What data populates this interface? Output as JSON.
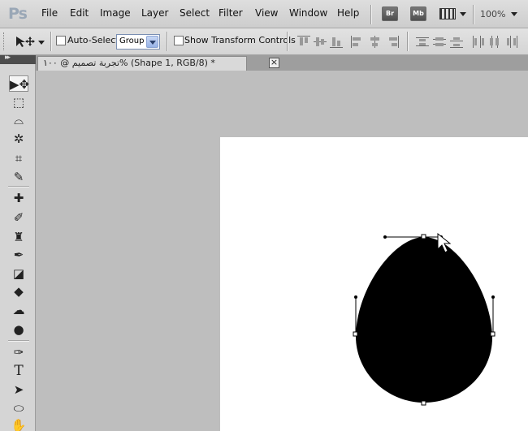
{
  "app": {
    "logo": "Ps",
    "zoom": "100%"
  },
  "menu": [
    "File",
    "Edit",
    "Image",
    "Layer",
    "Select",
    "Filter",
    "View",
    "Window",
    "Help"
  ],
  "app_buttons": {
    "bridge": "Br",
    "mini_bridge": "Mb"
  },
  "options": {
    "auto_select_label": "Auto-Select:",
    "auto_select_value": "Group",
    "show_transform_label": "Show Transform Controls"
  },
  "document": {
    "tab_title": "تجربة تصميم @ ١٠٠% (Shape 1, RGB/8) *",
    "close_glyph": "×"
  },
  "tools": [
    {
      "name": "move-tool",
      "glyph": "▶✥"
    },
    {
      "name": "marquee-tool",
      "glyph": "⬚"
    },
    {
      "name": "lasso-tool",
      "glyph": "⌓"
    },
    {
      "name": "quick-selection-tool",
      "glyph": "✲"
    },
    {
      "name": "crop-tool",
      "glyph": "⌗"
    },
    {
      "name": "eyedropper-tool",
      "glyph": "✎"
    },
    {
      "name": "healing-brush-tool",
      "glyph": "✚"
    },
    {
      "name": "brush-tool",
      "glyph": "✐"
    },
    {
      "name": "clone-stamp-tool",
      "glyph": "♜"
    },
    {
      "name": "history-brush-tool",
      "glyph": "✒"
    },
    {
      "name": "eraser-tool",
      "glyph": "◪"
    },
    {
      "name": "paint-bucket-tool",
      "glyph": "◆"
    },
    {
      "name": "blur-tool",
      "glyph": "☁"
    },
    {
      "name": "dodge-tool",
      "glyph": "●"
    },
    {
      "name": "pen-tool",
      "glyph": "✑"
    },
    {
      "name": "type-tool",
      "glyph": "T"
    },
    {
      "name": "path-selection-tool",
      "glyph": "➤"
    },
    {
      "name": "ellipse-tool",
      "glyph": "⬭"
    },
    {
      "name": "hand-tool",
      "glyph": "✋"
    }
  ],
  "colors": {
    "shape_fill": "#000000",
    "canvas_bg": "#ffffff",
    "workspace_bg": "#bebebe"
  }
}
